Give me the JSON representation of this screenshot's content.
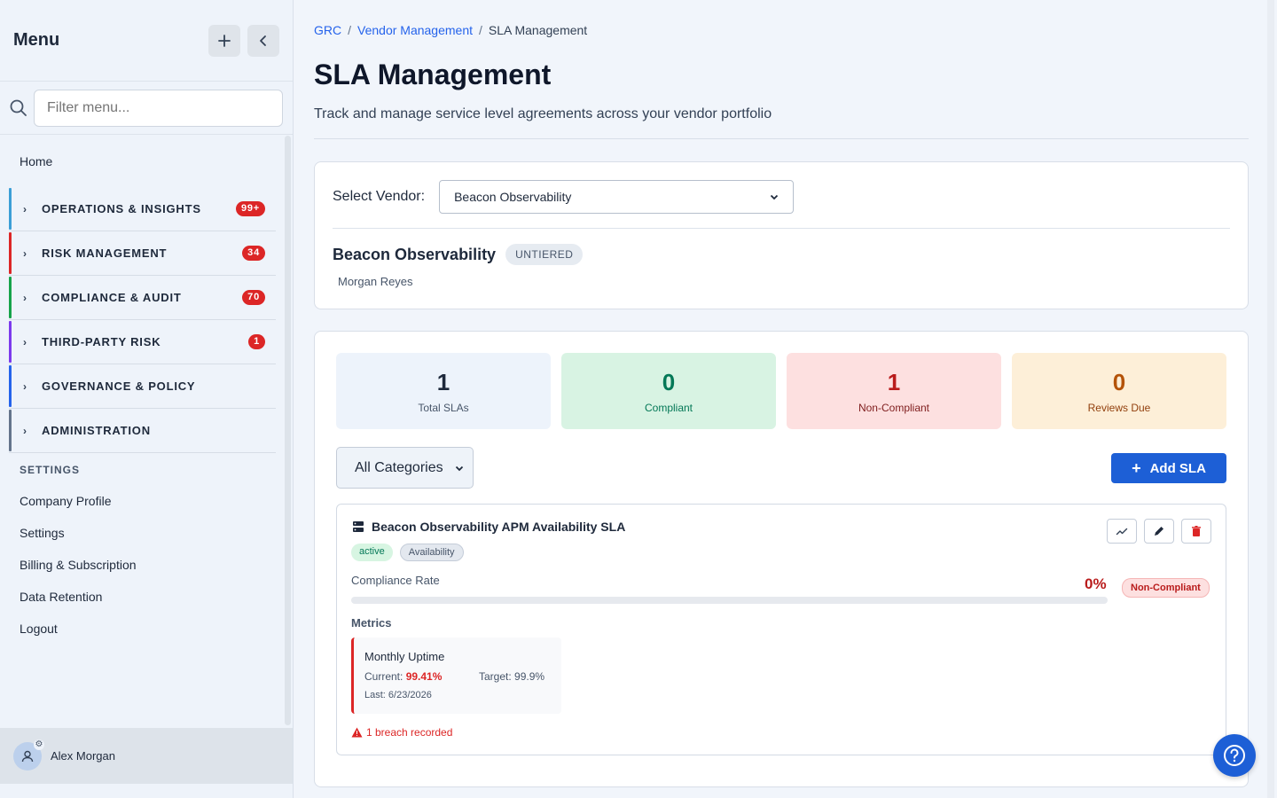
{
  "sidebar": {
    "title": "Menu",
    "filter_placeholder": "Filter menu...",
    "home": "Home",
    "sections": [
      {
        "label": "OPERATIONS & INSIGHTS",
        "badge": "99+",
        "color": "#3b9ed6"
      },
      {
        "label": "RISK MANAGEMENT",
        "badge": "34",
        "color": "#dc2626"
      },
      {
        "label": "COMPLIANCE & AUDIT",
        "badge": "70",
        "color": "#16a34a"
      },
      {
        "label": "THIRD-PARTY RISK",
        "badge": "1",
        "color": "#7c3aed"
      },
      {
        "label": "GOVERNANCE & POLICY",
        "badge": "",
        "color": "#2563eb"
      },
      {
        "label": "ADMINISTRATION",
        "badge": "",
        "color": "#64748b"
      }
    ],
    "settings_heading": "SETTINGS",
    "settings_items": [
      "Company Profile",
      "Settings",
      "Billing & Subscription",
      "Data Retention",
      "Logout"
    ],
    "user_name": "Alex Morgan"
  },
  "breadcrumb": [
    "GRC",
    "Vendor Management",
    "SLA Management"
  ],
  "page": {
    "title": "SLA Management",
    "subtitle": "Track and manage service level agreements across your vendor portfolio"
  },
  "vendor": {
    "select_label": "Select Vendor:",
    "selected": "Beacon Observability",
    "name": "Beacon Observability",
    "tier": "UNTIERED",
    "owner": "Morgan Reyes"
  },
  "stats": [
    {
      "value": "1",
      "label": "Total SLAs"
    },
    {
      "value": "0",
      "label": "Compliant"
    },
    {
      "value": "1",
      "label": "Non-Compliant"
    },
    {
      "value": "0",
      "label": "Reviews Due"
    }
  ],
  "filter": {
    "category": "All Categories"
  },
  "add_sla_label": "Add SLA",
  "sla": {
    "title": "Beacon Observability APM Availability SLA",
    "status_tag": "active",
    "category_tag": "Availability",
    "compliance_label": "Compliance Rate",
    "compliance_value": "0%",
    "compliance_fraction": 0,
    "compliance_status": "Non-Compliant",
    "metrics_label": "Metrics",
    "metric": {
      "name": "Monthly Uptime",
      "current_label": "Current:",
      "current_value": "99.41%",
      "target": "Target: 99.9%",
      "last": "Last: 6/23/2026"
    },
    "breach_text": "1 breach recorded"
  },
  "icons": {
    "search": "search-icon",
    "add": "plus-icon",
    "collapse": "chevron-left-icon",
    "server": "server-icon",
    "trend": "trend-icon",
    "edit": "pencil-icon",
    "delete": "trash-icon",
    "warning": "warning-icon",
    "help": "help-icon"
  },
  "colors": {
    "accent": "#1d5fd6",
    "danger": "#dc2626",
    "success": "#047857"
  }
}
